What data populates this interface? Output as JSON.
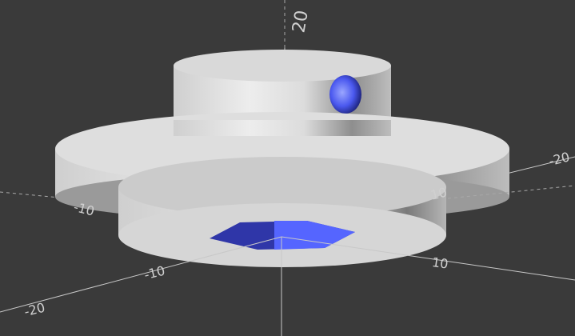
{
  "viewport": {
    "background_color": "#3a3a3a",
    "model_color": "#e6e6e6",
    "cutout_color": "#4c5cf2"
  },
  "axis_labels": {
    "z_top": "20",
    "x_neg": "-10",
    "x_pos": "10",
    "y_neg": "-10",
    "y_pos": "10",
    "x_far_left": "-20",
    "x_far_right": "-20",
    "y_right": "10"
  }
}
